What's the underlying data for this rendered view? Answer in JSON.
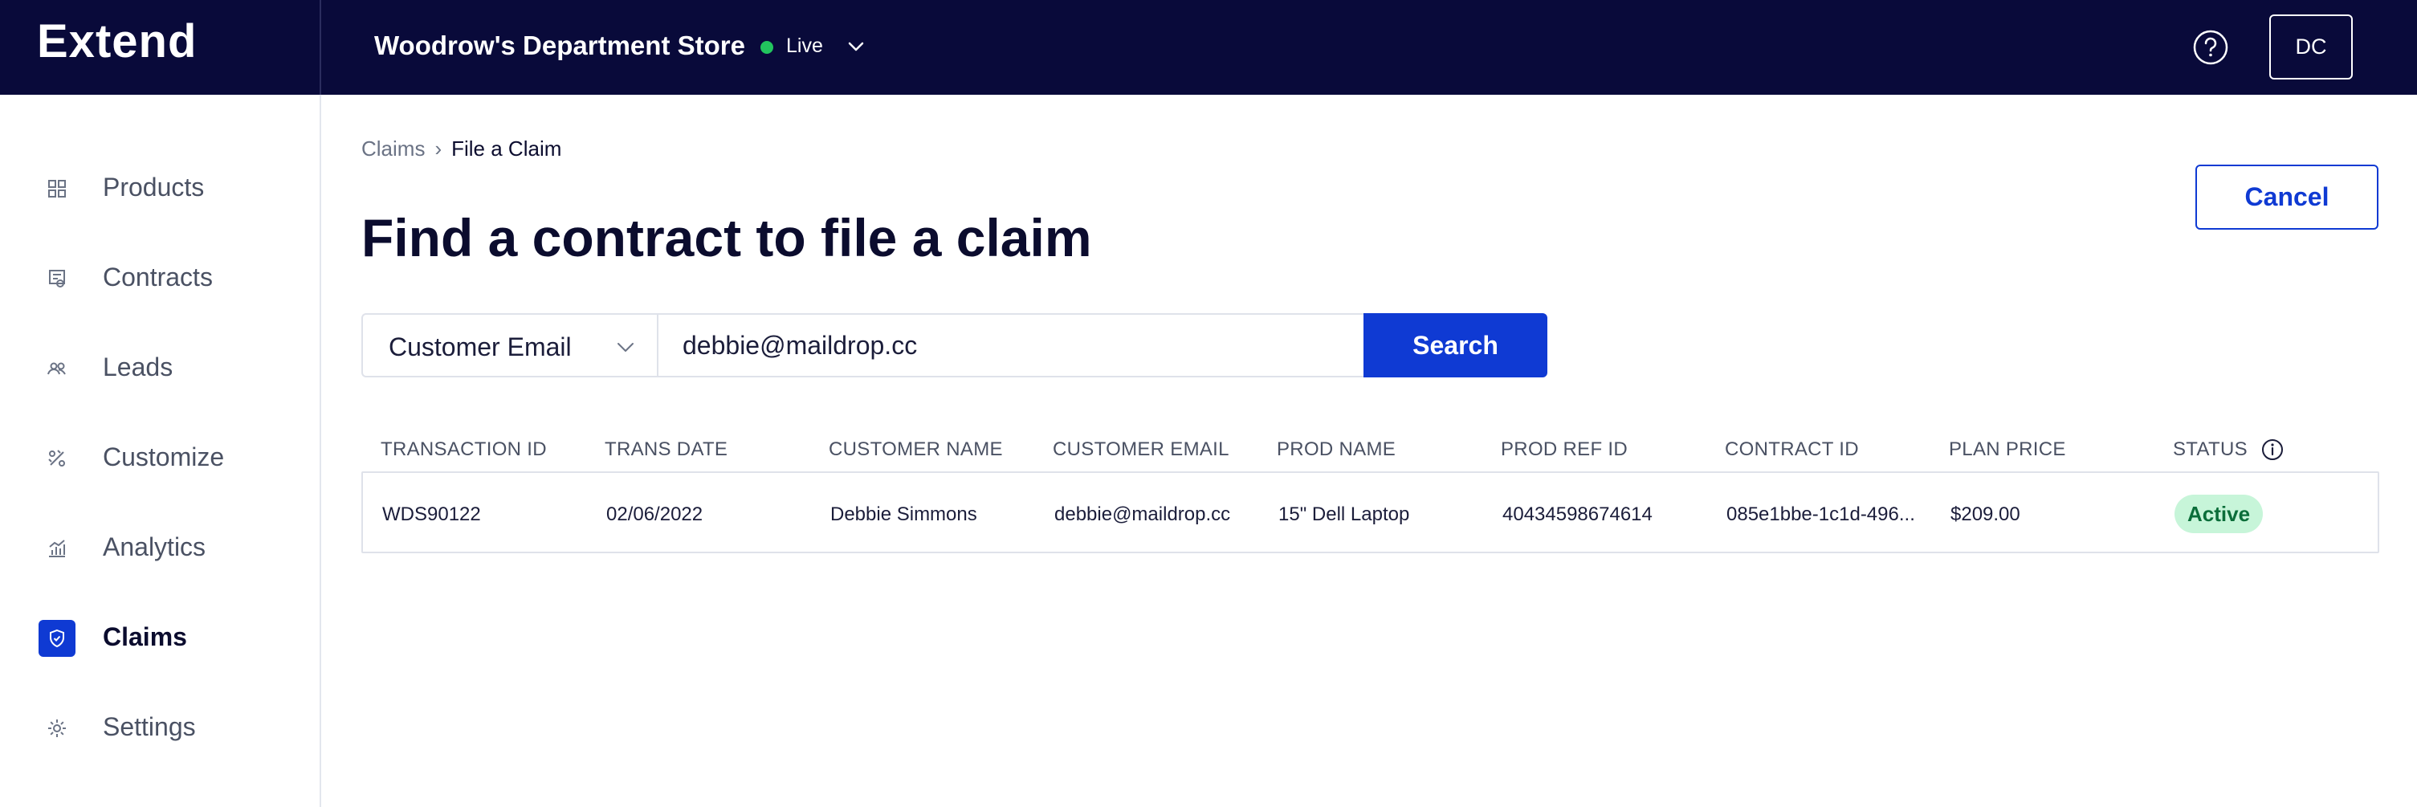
{
  "app": {
    "logo": "Extend"
  },
  "header": {
    "store_name": "Woodrow's Department Store",
    "status_label": "Live",
    "avatar_initials": "DC",
    "status_color": "#22c55e",
    "bar_color": "#090a3a"
  },
  "sidebar": {
    "items": [
      {
        "label": "Products",
        "icon": "grid-icon"
      },
      {
        "label": "Contracts",
        "icon": "contract-icon"
      },
      {
        "label": "Leads",
        "icon": "people-icon"
      },
      {
        "label": "Customize",
        "icon": "customize-icon"
      },
      {
        "label": "Analytics",
        "icon": "analytics-icon"
      },
      {
        "label": "Claims",
        "icon": "shield-icon",
        "active": true
      },
      {
        "label": "Settings",
        "icon": "gear-icon"
      }
    ]
  },
  "breadcrumb": {
    "parent": "Claims",
    "current": "File a Claim"
  },
  "page": {
    "title": "Find a contract to file a claim",
    "cancel_label": "Cancel"
  },
  "search": {
    "field_select": "Customer Email",
    "query": "debbie@maildrop.cc",
    "button_label": "Search",
    "accent_color": "#0f3ad3"
  },
  "table": {
    "columns": [
      "TRANSACTION ID",
      "TRANS DATE",
      "CUSTOMER NAME",
      "CUSTOMER EMAIL",
      "PROD NAME",
      "PROD REF ID",
      "CONTRACT ID",
      "PLAN PRICE",
      "STATUS"
    ],
    "rows": [
      {
        "transaction_id": "WDS90122",
        "trans_date": "02/06/2022",
        "customer_name": "Debbie Simmons",
        "customer_email": "debbie@maildrop.cc",
        "prod_name": "15\" Dell Laptop",
        "prod_ref_id": "40434598674614",
        "contract_id": "085e1bbe-1c1d-496...",
        "plan_price": "$209.00",
        "status": "Active"
      }
    ]
  }
}
